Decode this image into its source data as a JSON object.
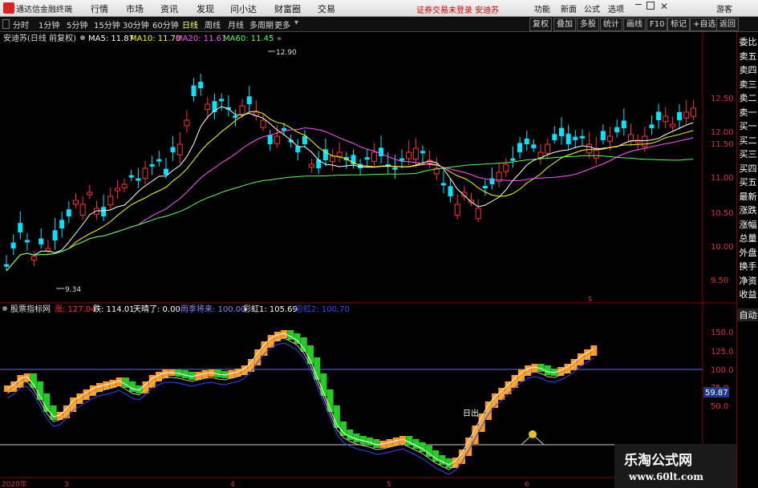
{
  "menubar": {
    "app_title": "通达信金融终端",
    "items": [
      "行情",
      "市场",
      "资讯",
      "发现",
      "问小达",
      "财富圈",
      "交易"
    ],
    "notice": "证券交易未登录",
    "stock": "安迪苏",
    "right_items": [
      "功能",
      "新面",
      "公式",
      "选项"
    ],
    "user": "游客"
  },
  "toolbar": {
    "timeframes": [
      "分时",
      "1分钟",
      "5分钟",
      "15分钟",
      "30分钟",
      "60分钟",
      "日线",
      "周线",
      "月线",
      "多周期",
      "更多"
    ],
    "active": "日线",
    "buttons": [
      "复权",
      "叠加",
      "多股",
      "统计",
      "画线",
      "F10",
      "标记",
      "+自选",
      "返回"
    ]
  },
  "main_chart": {
    "title": "安迪苏(日线 前复权)",
    "ma": [
      {
        "label": "MA5: 11.87",
        "color": "#ffffff"
      },
      {
        "label": "MA10: 11.70",
        "color": "#ffff00"
      },
      {
        "label": "MA20: 11.61",
        "color": "#ff55ff"
      },
      {
        "label": "MA60: 11.45",
        "color": "#55ff55"
      }
    ],
    "y_labels": [
      "12.50",
      "12.00",
      "11.50",
      "11.00",
      "10.50",
      "10.00",
      "9.50"
    ],
    "high_label": "12.90",
    "low_label": "9.34"
  },
  "indicator": {
    "name": "股票指标网",
    "values": [
      {
        "label": "涨: 127.04",
        "color": "#ff3333"
      },
      {
        "label": "跌: 114.01",
        "color": "#ffffff"
      },
      {
        "label": "天晴了: 0.00",
        "color": "#ffffff"
      },
      {
        "label": "雨季将来: 100.00",
        "color": "#8888ff"
      },
      {
        "label": "彩虹1: 105.69",
        "color": "#ffffff"
      },
      {
        "label": "彩虹2: 100.70",
        "color": "#4444ff"
      }
    ],
    "y_labels": [
      "150.0",
      "125.0",
      "100.0",
      "75.0",
      "50.0"
    ],
    "current": "59.87",
    "annotation": "日出"
  },
  "x_axis": [
    "2020年",
    "3",
    "4",
    "5",
    "6"
  ],
  "sidebar": [
    "委比",
    "卖五",
    "卖四",
    "卖三",
    "卖二",
    "卖一",
    "买一",
    "买二",
    "买三",
    "买四",
    "买五",
    "最新",
    "涨跌",
    "涨幅",
    "总量",
    "外盘",
    "换手",
    "净资",
    "收益",
    "自动"
  ],
  "watermark": {
    "line1": "乐淘公式网",
    "line2": "www.60lt.com"
  },
  "colors": {
    "up": "#ff3333",
    "down": "#00ffff",
    "bg": "#000000",
    "axis": "#8b0000"
  }
}
